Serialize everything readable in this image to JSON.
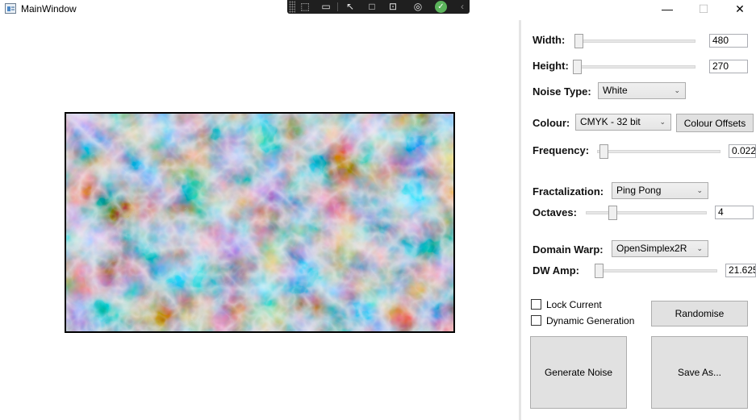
{
  "window": {
    "title": "MainWindow",
    "minimize_glyph": "—",
    "maximize_glyph": "☐",
    "close_glyph": "✕"
  },
  "debug_toolbar": {
    "icons": [
      "select-element-icon",
      "video-icon",
      "pointer-icon",
      "layout-adorner-icon",
      "track-focus-icon",
      "hot-reload-icon",
      "check-icon",
      "collapse-icon"
    ]
  },
  "canvas": {
    "alt": "generated noise image"
  },
  "controls": {
    "width": {
      "label": "Width:",
      "value": "480",
      "slider_fraction": 0.0
    },
    "height": {
      "label": "Height:",
      "value": "270",
      "slider_fraction": 0.0
    },
    "noise_type": {
      "label": "Noise Type:",
      "selected": "White"
    },
    "colour": {
      "label": "Colour:",
      "selected": "CMYK - 32 bit",
      "offsets_button": "Colour Offsets"
    },
    "frequency": {
      "label": "Frequency:",
      "value": "0.022",
      "slider_fraction": 0.02
    },
    "fractalization": {
      "label": "Fractalization:",
      "selected": "Ping Pong"
    },
    "octaves": {
      "label": "Octaves:",
      "value": "4",
      "slider_fraction": 0.2
    },
    "domain_warp": {
      "label": "Domain Warp:",
      "selected": "OpenSimplex2R"
    },
    "dw_amp": {
      "label": "DW Amp:",
      "value": "21.625",
      "slider_fraction": 0.0
    },
    "lock_current": {
      "label": "Lock Current",
      "checked": false
    },
    "dynamic_generation": {
      "label": "Dynamic Generation",
      "checked": false
    },
    "randomise_button": "Randomise",
    "generate_button": "Generate Noise",
    "save_button": "Save As..."
  },
  "colors": {
    "panel_divider": "#e5e5e5",
    "button_bg": "#e1e1e1",
    "button_border": "#adadad"
  }
}
